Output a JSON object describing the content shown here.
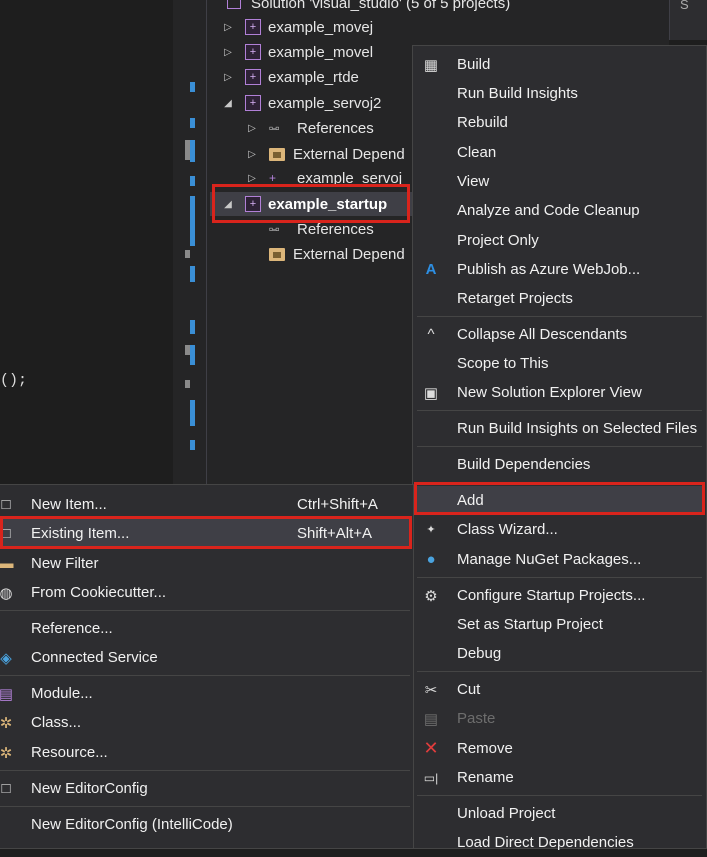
{
  "editor": {
    "code_fragment": "();"
  },
  "explorer": {
    "solution_label": "Solution 'visual_studio' (5 of 5 projects)",
    "rows": [
      {
        "label": "example_movej",
        "kind": "project",
        "expanded": false
      },
      {
        "label": "example_movel",
        "kind": "project",
        "expanded": false
      },
      {
        "label": "example_rtde",
        "kind": "project",
        "expanded": false
      },
      {
        "label": "example_servoj2",
        "kind": "project",
        "expanded": true
      },
      {
        "label": "References",
        "kind": "references",
        "expanded": false
      },
      {
        "label": "External Depend",
        "kind": "external",
        "expanded": false
      },
      {
        "label": "example_servoj",
        "kind": "file",
        "expanded": false
      },
      {
        "label": "example_startup",
        "kind": "project",
        "expanded": true,
        "selected": true
      },
      {
        "label": "References",
        "kind": "references",
        "expanded": false
      },
      {
        "label": "External Depend",
        "kind": "external",
        "expanded": false
      }
    ]
  },
  "context_menu": {
    "items": [
      {
        "label": "Build",
        "icon": "build-icon"
      },
      {
        "label": "Run Build Insights",
        "icon": ""
      },
      {
        "label": "Rebuild",
        "icon": ""
      },
      {
        "label": "Clean",
        "icon": ""
      },
      {
        "label": "View",
        "icon": ""
      },
      {
        "label": "Analyze and Code Cleanup",
        "icon": ""
      },
      {
        "label": "Project Only",
        "icon": ""
      },
      {
        "label": "Publish as Azure WebJob...",
        "icon": "azure-icon"
      },
      {
        "label": "Retarget Projects",
        "icon": ""
      },
      {
        "label": "Collapse All Descendants",
        "icon": "collapse-icon"
      },
      {
        "label": "Scope to This",
        "icon": ""
      },
      {
        "label": "New Solution Explorer View",
        "icon": "new-view-icon"
      },
      {
        "label": "Run Build Insights on Selected Files",
        "icon": ""
      },
      {
        "label": "Build Dependencies",
        "icon": ""
      },
      {
        "label": "Add",
        "icon": ""
      },
      {
        "label": "Class Wizard...",
        "icon": "class-wizard-icon"
      },
      {
        "label": "Manage NuGet Packages...",
        "icon": "nuget-icon"
      },
      {
        "label": "Configure Startup Projects...",
        "icon": "gear-icon"
      },
      {
        "label": "Set as Startup Project",
        "icon": ""
      },
      {
        "label": "Debug",
        "icon": ""
      },
      {
        "label": "Cut",
        "icon": "scissors-icon"
      },
      {
        "label": "Paste",
        "icon": "paste-icon",
        "disabled": true
      },
      {
        "label": "Remove",
        "icon": "remove-icon"
      },
      {
        "label": "Rename",
        "icon": "rename-icon"
      },
      {
        "label": "Unload Project",
        "icon": ""
      },
      {
        "label": "Load Direct Dependencies",
        "icon": ""
      }
    ]
  },
  "add_submenu": {
    "items": [
      {
        "label": "New Item...",
        "shortcut": "Ctrl+Shift+A",
        "icon": "new-item-icon"
      },
      {
        "label": "Existing Item...",
        "shortcut": "Shift+Alt+A",
        "icon": "existing-item-icon"
      },
      {
        "label": "New Filter",
        "shortcut": "",
        "icon": "folder-icon"
      },
      {
        "label": "From Cookiecutter...",
        "shortcut": "",
        "icon": "cookiecutter-icon"
      },
      {
        "label": "Reference...",
        "shortcut": "",
        "icon": ""
      },
      {
        "label": "Connected Service",
        "shortcut": "",
        "icon": "connected-service-icon"
      },
      {
        "label": "Module...",
        "shortcut": "",
        "icon": "module-icon"
      },
      {
        "label": "Class...",
        "shortcut": "",
        "icon": "class-icon"
      },
      {
        "label": "Resource...",
        "shortcut": "",
        "icon": "resource-icon"
      },
      {
        "label": "New EditorConfig",
        "shortcut": "",
        "icon": "editorconfig-icon"
      },
      {
        "label": "New EditorConfig (IntelliCode)",
        "shortcut": "",
        "icon": ""
      }
    ]
  },
  "colors": {
    "highlight_box": "#d9241c",
    "accent_purple": "#b180d7",
    "azure_blue": "#2d8fe3",
    "remove_red": "#e03c3c"
  }
}
